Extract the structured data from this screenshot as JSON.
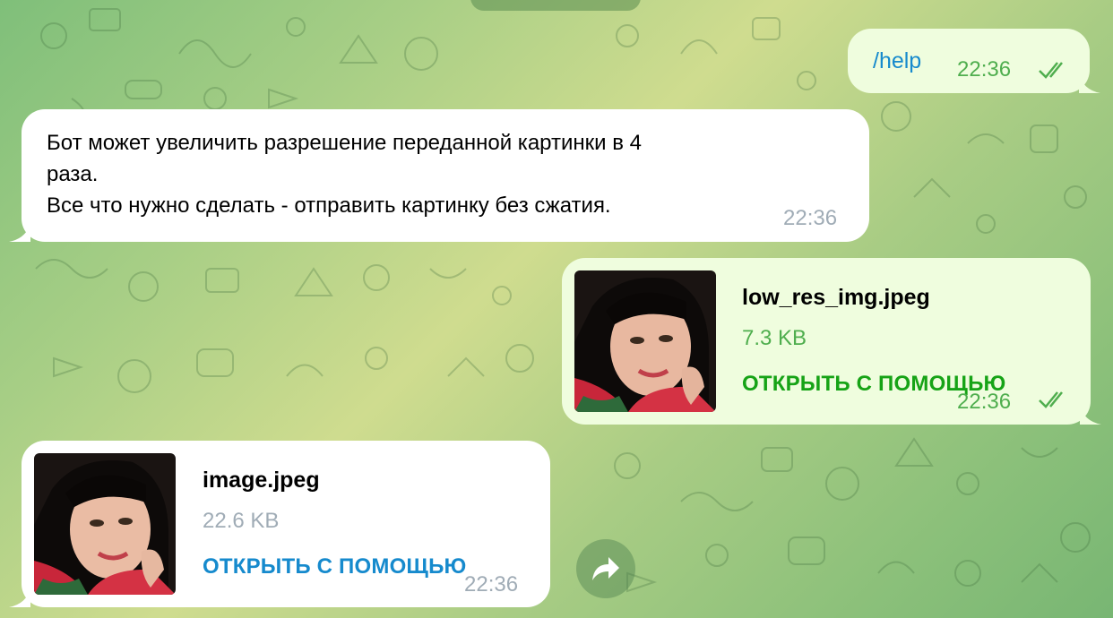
{
  "messages": [
    {
      "type": "command",
      "text": "/help",
      "time": "22:36",
      "read": true
    },
    {
      "type": "text",
      "lines": [
        "Бот может увеличить разрешение переданной картинки в 4",
        "раза.",
        "Все что нужно сделать - отправить картинку без сжатия."
      ],
      "time": "22:36"
    },
    {
      "type": "file",
      "direction": "out",
      "filename": "low_res_img.jpeg",
      "size": "7.3 KB",
      "action": "ОТКРЫТЬ С ПОМОЩЬЮ",
      "time": "22:36",
      "read": true
    },
    {
      "type": "file",
      "direction": "in",
      "filename": "image.jpeg",
      "size": "22.6 KB",
      "action": "ОТКРЫТЬ С ПОМОЩЬЮ",
      "time": "22:36"
    }
  ],
  "icons": {
    "read_receipt": "double-check-icon",
    "share": "share-arrow-icon"
  },
  "colors": {
    "out_bubble": "#effdde",
    "in_bubble": "#ffffff",
    "link_blue": "#168acd",
    "out_green": "#4fae4e",
    "action_green": "#16a316"
  }
}
